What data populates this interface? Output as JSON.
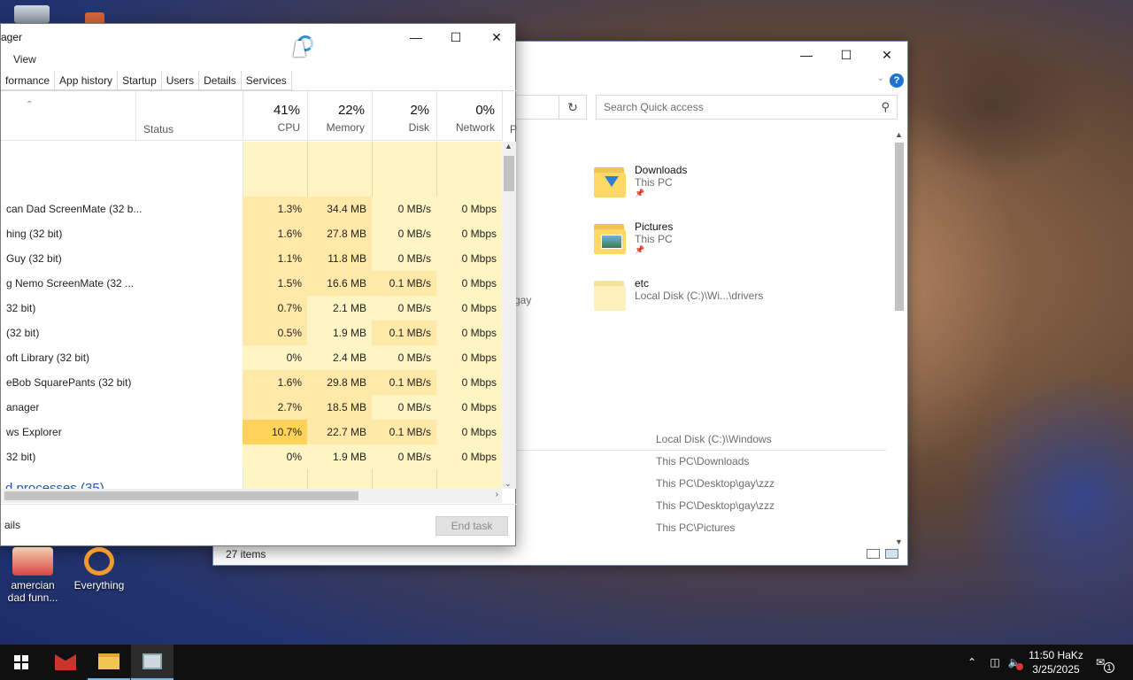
{
  "desktop": {
    "icons": [
      {
        "label": "amercian dad funn..."
      },
      {
        "label": "Everything"
      }
    ]
  },
  "explorer": {
    "search_placeholder": "Search Quick access",
    "help": "?",
    "quick_access": [
      {
        "name": "Downloads",
        "location": "This PC"
      },
      {
        "name": "Pictures",
        "location": "This PC"
      },
      {
        "name": "etc",
        "location": "Local Disk (C:)\\Wi...\\drivers"
      }
    ],
    "left_fragment": "gay",
    "recent_paths": [
      "Local Disk (C:)\\Windows",
      "This PC\\Downloads",
      "This PC\\Desktop\\gay\\zzz",
      "This PC\\Desktop\\gay\\zzz",
      "This PC\\Pictures"
    ],
    "status": "27 items"
  },
  "taskmanager": {
    "title": "ager",
    "menu": [
      "View"
    ],
    "tabs": [
      "formance",
      "App history",
      "Startup",
      "Users",
      "Details",
      "Services"
    ],
    "columns": {
      "status": "Status",
      "cpu": {
        "pct": "41%",
        "label": "CPU"
      },
      "memory": {
        "pct": "22%",
        "label": "Memory"
      },
      "disk": {
        "pct": "2%",
        "label": "Disk"
      },
      "network": {
        "pct": "0%",
        "label": "Network"
      },
      "extra": "P"
    },
    "rows": [
      {
        "name": "can Dad ScreenMate (32 b...",
        "cpu": "1.3%",
        "mem": "34.4 MB",
        "disk": "0 MB/s",
        "net": "0 Mbps"
      },
      {
        "name": "hing (32 bit)",
        "cpu": "1.6%",
        "mem": "27.8 MB",
        "disk": "0 MB/s",
        "net": "0 Mbps"
      },
      {
        "name": "Guy (32 bit)",
        "cpu": "1.1%",
        "mem": "11.8 MB",
        "disk": "0 MB/s",
        "net": "0 Mbps"
      },
      {
        "name": "g Nemo ScreenMate (32 ...",
        "cpu": "1.5%",
        "mem": "16.6 MB",
        "disk": "0.1 MB/s",
        "net": "0 Mbps"
      },
      {
        "name": "32 bit)",
        "cpu": "0.7%",
        "mem": "2.1 MB",
        "disk": "0 MB/s",
        "net": "0 Mbps"
      },
      {
        "name": "(32 bit)",
        "cpu": "0.5%",
        "mem": "1.9 MB",
        "disk": "0.1 MB/s",
        "net": "0 Mbps"
      },
      {
        "name": "oft Library (32 bit)",
        "cpu": "0%",
        "mem": "2.4 MB",
        "disk": "0 MB/s",
        "net": "0 Mbps"
      },
      {
        "name": "eBob SquarePants (32 bit)",
        "cpu": "1.6%",
        "mem": "29.8 MB",
        "disk": "0.1 MB/s",
        "net": "0 Mbps"
      },
      {
        "name": "anager",
        "cpu": "2.7%",
        "mem": "18.5 MB",
        "disk": "0 MB/s",
        "net": "0 Mbps"
      },
      {
        "name": "ws Explorer",
        "cpu": "10.7%",
        "mem": "22.7 MB",
        "disk": "0.1 MB/s",
        "net": "0 Mbps"
      },
      {
        "name": "32 bit)",
        "cpu": "0%",
        "mem": "1.9 MB",
        "disk": "0 MB/s",
        "net": "0 Mbps"
      }
    ],
    "section_label": "d processes (35)",
    "fewer_details": "ails",
    "end_task": "End task"
  },
  "taskbar": {
    "clock_time": "11:50 HaKz",
    "clock_date": "3/25/2025",
    "notification_count": "1"
  },
  "colors": {
    "cell_light": "#fff4c4",
    "cell_mid": "#ffe9a8",
    "cell_hot": "#ffd35a",
    "accent": "#1e5aa8"
  }
}
